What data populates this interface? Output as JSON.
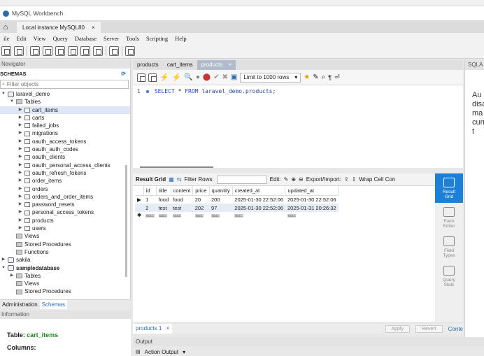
{
  "window": {
    "title": "MySQL Workbench",
    "tab": "Local instance MySQL80",
    "close": "×"
  },
  "menu": [
    "ile",
    "Edit",
    "View",
    "Query",
    "Database",
    "Server",
    "Tools",
    "Scripting",
    "Help"
  ],
  "navigator": {
    "header": "Navigator",
    "schemas_label": "SCHEMAS",
    "filter_placeholder": "Filter objects",
    "tree": [
      {
        "label": "laravel_demo",
        "level": 0,
        "expanded": true,
        "kind": "db",
        "bold": false
      },
      {
        "label": "Tables",
        "level": 1,
        "expanded": true,
        "kind": "folder"
      },
      {
        "label": "cart_items",
        "level": 2,
        "kind": "table",
        "selected": true
      },
      {
        "label": "carts",
        "level": 2,
        "kind": "table"
      },
      {
        "label": "failed_jobs",
        "level": 2,
        "kind": "table"
      },
      {
        "label": "migrations",
        "level": 2,
        "kind": "table"
      },
      {
        "label": "oauth_access_tokens",
        "level": 2,
        "kind": "table"
      },
      {
        "label": "oauth_auth_codes",
        "level": 2,
        "kind": "table"
      },
      {
        "label": "oauth_clients",
        "level": 2,
        "kind": "table"
      },
      {
        "label": "oauth_personal_access_clients",
        "level": 2,
        "kind": "table"
      },
      {
        "label": "oauth_refresh_tokens",
        "level": 2,
        "kind": "table"
      },
      {
        "label": "order_items",
        "level": 2,
        "kind": "table"
      },
      {
        "label": "orders",
        "level": 2,
        "kind": "table"
      },
      {
        "label": "orders_and_order_items",
        "level": 2,
        "kind": "table"
      },
      {
        "label": "password_resets",
        "level": 2,
        "kind": "table"
      },
      {
        "label": "personal_access_tokens",
        "level": 2,
        "kind": "table"
      },
      {
        "label": "products",
        "level": 2,
        "kind": "table"
      },
      {
        "label": "users",
        "level": 2,
        "kind": "table"
      },
      {
        "label": "Views",
        "level": 1,
        "kind": "folder",
        "leaf": true
      },
      {
        "label": "Stored Procedures",
        "level": 1,
        "kind": "folder",
        "leaf": true
      },
      {
        "label": "Functions",
        "level": 1,
        "kind": "folder",
        "leaf": true
      },
      {
        "label": "sakila",
        "level": 0,
        "expanded": false,
        "kind": "db"
      },
      {
        "label": "sampledatabase",
        "level": 0,
        "expanded": true,
        "kind": "db",
        "bold": true
      },
      {
        "label": "Tables",
        "level": 1,
        "expanded": false,
        "kind": "folder"
      },
      {
        "label": "Views",
        "level": 1,
        "kind": "folder",
        "leaf": true
      },
      {
        "label": "Stored Procedures",
        "level": 1,
        "kind": "folder",
        "leaf": true
      }
    ],
    "tabs": {
      "administration": "Administration",
      "schemas": "Schemas"
    }
  },
  "information": {
    "header": "Information",
    "table_label": "Table:",
    "table_value": "cart_items",
    "columns_label": "Columns:"
  },
  "query_tabs": [
    "products",
    "cart_items",
    "products"
  ],
  "query_toolbar": {
    "limit": "Limit to 1000 rows"
  },
  "editor": {
    "line_number": "1",
    "sql_kw1": "SELECT",
    "sql_star": "*",
    "sql_kw2": "FROM",
    "sql_rest": "laravel_demo.products;"
  },
  "result_bar": {
    "result_grid": "Result Grid",
    "filter_rows": "Filter Rows:",
    "edit": "Edit:",
    "export_import": "Export/Import:",
    "wrap": "Wrap Cell Con"
  },
  "grid": {
    "columns": [
      "id",
      "title",
      "content",
      "price",
      "quantity",
      "created_at",
      "updated_at"
    ],
    "rows": [
      [
        "1",
        "food",
        "food",
        "20",
        "200",
        "2025-01-30 22:52:06",
        "2025-01-30 22:52:06"
      ],
      [
        "2",
        "test",
        "test",
        "202",
        "97",
        "2025-01-30 22:52:06",
        "2025-01-31 20:26:32"
      ]
    ],
    "null_label": "NULL"
  },
  "side_panel": [
    {
      "label": "Result\nGrid",
      "active": true
    },
    {
      "label": "Form\nEditor"
    },
    {
      "label": "Field\nTypes"
    },
    {
      "label": "Query\nStats"
    }
  ],
  "bottom": {
    "tab": "products 1",
    "apply": "Apply",
    "revert": "Revert",
    "context": "Conte"
  },
  "output": {
    "header": "Output",
    "select": "Action Output"
  },
  "sql_additions": {
    "header": "SQLA",
    "text": [
      "Au",
      "disa",
      "ma",
      "curr",
      "t"
    ]
  },
  "colors": {
    "accent": "#1e7fd8",
    "active_tab": "#b0bccb",
    "table_name": "#1a8a1a"
  }
}
